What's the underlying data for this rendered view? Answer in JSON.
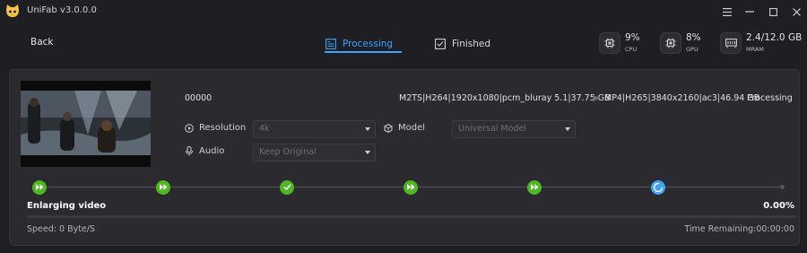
{
  "app": {
    "title": "UniFab v3.0.0.0",
    "logo_icon": "cat-face-icon",
    "accent": "#3da1ff",
    "success": "#4db81f"
  },
  "window_controls": [
    "menu-icon",
    "minimize-icon",
    "maximize-icon",
    "close-icon"
  ],
  "toolbar": {
    "back_label": "Back",
    "tabs": [
      {
        "label": "Processing",
        "icon": "document-list-icon",
        "active": true
      },
      {
        "label": "Finished",
        "icon": "checklist-icon",
        "active": false
      }
    ],
    "stats": [
      {
        "value": "9%",
        "label": "CPU",
        "icon": "cpu-chip-icon"
      },
      {
        "value": "8%",
        "label": "GPU",
        "icon": "gpu-chip-icon"
      },
      {
        "value": "2.4/12.0 GB",
        "label": "MRAM",
        "icon": "memory-icon"
      }
    ]
  },
  "task": {
    "name": "00000",
    "source": "M2TS|H264|1920x1080|pcm_bluray 5.1|37.75 GB",
    "target": "MP4|H265|3840x2160|ac3|46.94 GB",
    "status": "Processing",
    "resolution": {
      "label": "Resolution",
      "value": "4k"
    },
    "model": {
      "label": "Model",
      "value": "Universal Model"
    },
    "audio": {
      "label": "Audio",
      "value": "Keep Original"
    },
    "steps": [
      "done",
      "done",
      "done",
      "done",
      "done",
      "active",
      "pending"
    ],
    "phase": "Enlarging video",
    "progress_text": "0.00%",
    "progress_fraction": 0.0,
    "speed": "Speed: 0 Byte/S",
    "remaining": "Time Remaining:00:00:00"
  }
}
